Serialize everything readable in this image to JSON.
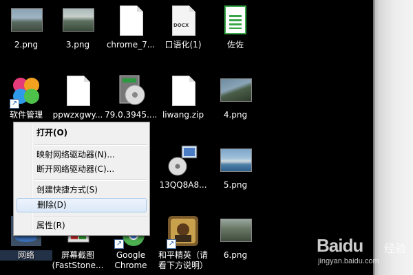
{
  "desktop": {
    "icons": [
      {
        "label": "2.png"
      },
      {
        "label": "3.png"
      },
      {
        "label": "chrome_7..."
      },
      {
        "label": "口语化(1)"
      },
      {
        "label": "佐佐"
      },
      {
        "label": "软件管理"
      },
      {
        "label": "ppwzxgwy..."
      },
      {
        "label": "79.0.3945...."
      },
      {
        "label": "liwang.zip"
      },
      {
        "label": "4.png"
      },
      {
        "label": "13QQ8A8..."
      },
      {
        "label": "5.png"
      },
      {
        "label": "网络"
      },
      {
        "label": "屏幕截图 (FastStone..."
      },
      {
        "label": "Google Chrome"
      },
      {
        "label": "和平精英（请看下方说明）"
      },
      {
        "label": "6.png"
      }
    ],
    "docx_badge": "DOCX"
  },
  "context_menu": {
    "items": [
      {
        "label": "打开(O)"
      },
      {
        "label": "映射网络驱动器(N)..."
      },
      {
        "label": "断开网络驱动器(C)..."
      },
      {
        "label": "创建快捷方式(S)"
      },
      {
        "label": "删除(D)"
      },
      {
        "label": "属性(R)"
      }
    ]
  },
  "watermark": {
    "brand": "Baidu",
    "brand_suffix": "经验",
    "url": "jingyan.baidu.com"
  },
  "colors": {
    "desktop_bg": "#000000",
    "menu_bg": "#f0f0f0",
    "menu_hover": "#dbe8f8",
    "label_text": "#ffffff"
  }
}
